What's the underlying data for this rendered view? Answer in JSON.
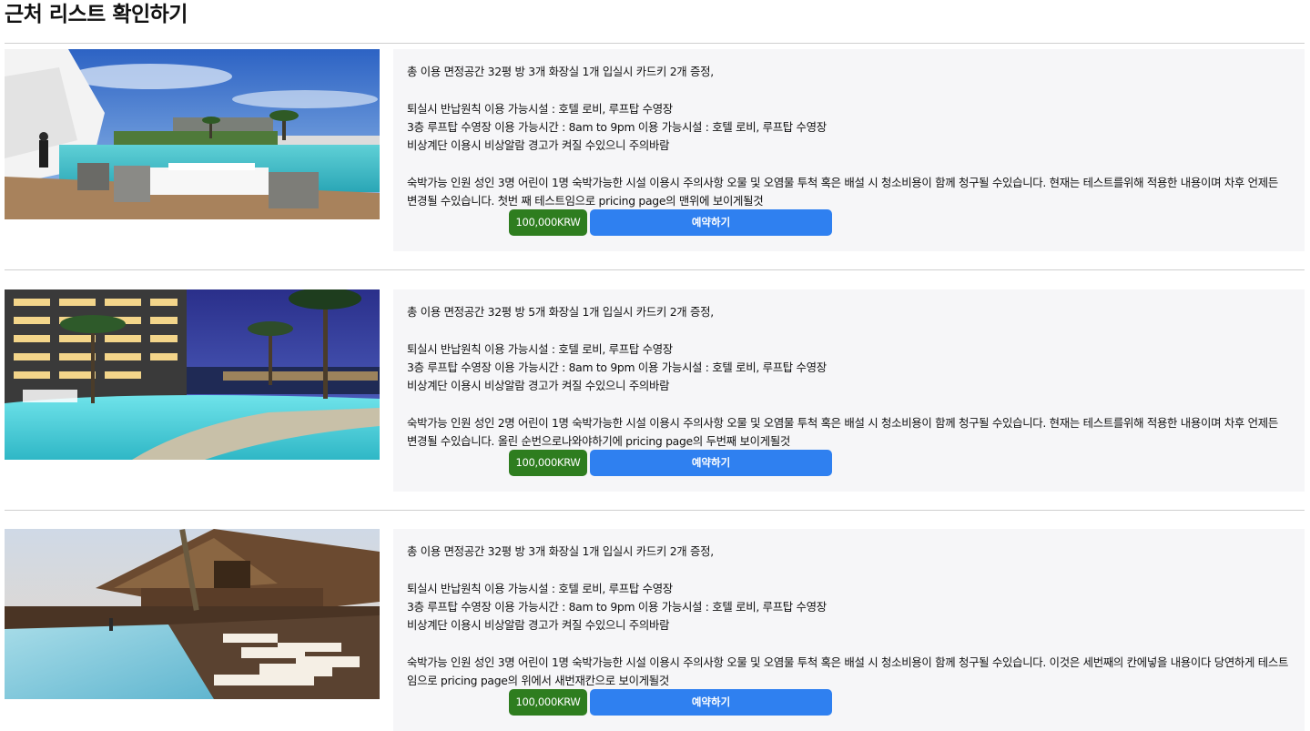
{
  "page": {
    "title": "근처 리스트 확인하기"
  },
  "listings": [
    {
      "photo_alt": "hotel-terrace-pool-photo",
      "line1": "총 이용 면정공간 32평 방 3개 화장실 1개 입실시 카드키 2개 증정,",
      "line2": "퇴실시 반납원칙 이용 가능시설 : 호텔 로비, 루프탑 수영장",
      "line3": "3층 루프탑 수영장 이용 가능시간 : 8am to 9pm 이용 가능시설 : 호텔 로비, 루프탑 수영장",
      "line4": "비상계단 이용시 비상알람 경고가 켜질 수있으니 주의바람",
      "notice": "숙박가능 인원 성인 3명 어린이 1명 숙박가능한 시설 이용시 주의사항 오물 및 오염물 투척 혹은 배설 시 청소비용이 함께 청구될 수있습니다. 현재는 테스트를위해 적용한 내용이며 차후 언제든 변경될 수있습니다. 첫번 째 테스트임으로 pricing page의 맨위에 보이게될것",
      "price": "100,000KRW",
      "reserve_label": "예약하기"
    },
    {
      "photo_alt": "resort-night-pool-photo",
      "line1": "총 이용 면정공간 32평 방 5개 화장실 1개 입실시 카드키 2개 증정,",
      "line2": "퇴실시 반납원칙 이용 가능시설 : 호텔 로비, 루프탑 수영장",
      "line3": "3층 루프탑 수영장 이용 가능시간 : 8am to 9pm 이용 가능시설 : 호텔 로비, 루프탑 수영장",
      "line4": "비상계단 이용시 비상알람 경고가 켜질 수있으니 주의바람",
      "notice": "숙박가능 인원 성인 2명 어린이 1명 숙박가능한 시설 이용시 주의사항 오물 및 오염물 투척 혹은 배설 시 청소비용이 함께 청구될 수있습니다. 현재는 테스트를위해 적용한 내용이며 차후 언제든 변경될 수있습니다. 올린 순번으로나와야하기에 pricing page의 두번째 보이게될것",
      "price": "100,000KRW",
      "reserve_label": "예약하기"
    },
    {
      "photo_alt": "wooden-villa-pool-photo",
      "line1": "총 이용 면정공간 32평 방 3개 화장실 1개 입실시 카드키 2개 증정,",
      "line2": "퇴실시 반납원칙 이용 가능시설 : 호텔 로비, 루프탑 수영장",
      "line3": "3층 루프탑 수영장 이용 가능시간 : 8am to 9pm 이용 가능시설 : 호텔 로비, 루프탑 수영장",
      "line4": "비상계단 이용시 비상알람 경고가 켜질 수있으니 주의바람",
      "notice": "숙박가능 인원 성인 3명 어린이 1명 숙박가능한 시설 이용시 주의사항 오물 및 오염물 투척 혹은 배설 시 청소비용이 함께 청구될 수있습니다. 이것은 세번째의 칸에넣을 내용이다 당연하게 테스트임으로 pricing page의 위에서 새번재칸으로 보이게될것",
      "price": "100,000KRW",
      "reserve_label": "예약하기"
    }
  ]
}
